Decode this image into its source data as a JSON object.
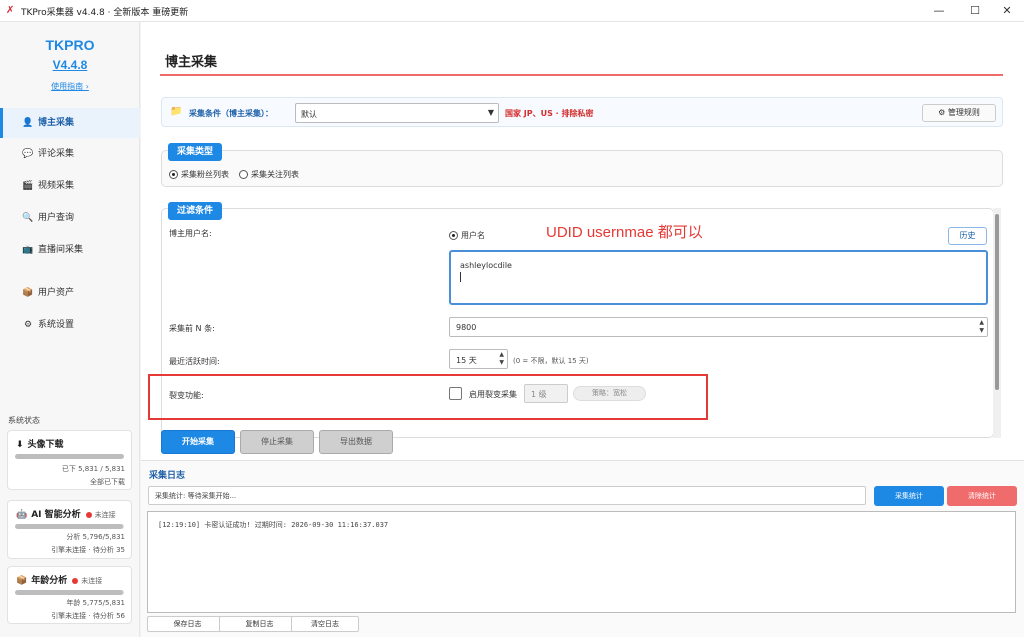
{
  "window": {
    "title": "TKPro采集器 v4.4.8 · 全新版本 重磅更新",
    "minimize": "—",
    "maximize": "☐",
    "close": "✕"
  },
  "sidebar": {
    "logo": "TKPRO",
    "version": "V4.4.8",
    "guide": "使用指南 ›",
    "items": [
      {
        "icon": "👤",
        "label": "博主采集"
      },
      {
        "icon": "💬",
        "label": "评论采集"
      },
      {
        "icon": "🎬",
        "label": "视频采集"
      },
      {
        "icon": "🔍",
        "label": "用户查询"
      },
      {
        "icon": "📺",
        "label": "直播间采集"
      },
      {
        "icon": "📦",
        "label": "用户资产"
      },
      {
        "icon": "⚙",
        "label": "系统设置"
      }
    ],
    "system_status": "系统状态",
    "cards": [
      {
        "icon": "⬇",
        "title": "头像下载",
        "status": "",
        "line1": "已下 5,831 / 5,831",
        "line2": "全部已下载",
        "progress": 1.0
      },
      {
        "icon": "🤖",
        "title": "AI 智能分析",
        "status": "未连接",
        "line1": "分析 5,796/5,831",
        "line2": "引擎未连接 · 待分析 35",
        "progress": 0.994
      },
      {
        "icon": "📦",
        "title": "年龄分析",
        "status": "未连接",
        "line1": "年龄 5,775/5,831",
        "line2": "引擎未连接 · 待分析 56",
        "progress": 0.99
      }
    ]
  },
  "main": {
    "page_title": "博主采集",
    "condition": {
      "label": "采集条件（博主采集）：",
      "selected": "默认",
      "note": "国家 JP、US · 排除私密",
      "manage_label": "管理规则"
    },
    "collect_type": {
      "tag": "采集类型",
      "options": [
        "采集粉丝列表",
        "采集关注列表"
      ],
      "selected_index": 0
    },
    "filter": {
      "tag": "过滤条件",
      "username_label": "博主用户名:",
      "username_radio": "用户名",
      "annotation": "UDID usernmae 都可以",
      "history_label": "历史",
      "username_value": "ashleylocdile",
      "topn_label": "采集前 N 条:",
      "topn_value": "9800",
      "active_label": "最近活跃时间:",
      "active_value": "15 天",
      "active_hint": "(0 = 不限，默认 15 天)",
      "fission_label": "裂变功能:",
      "fission_enable": "启用裂变采集",
      "fission_level": "1 级",
      "fission_strategy": "策略：宽松"
    },
    "actions": {
      "start": "开始采集",
      "stop": "停止采集",
      "export": "导出数据"
    },
    "log": {
      "title": "采集日志",
      "stats": "采集统计: 等待采集开始...",
      "stats_btn": "采集统计",
      "clear_stats_btn": "清除统计",
      "lines": [
        "[12:19:10] 卡密认证成功! 过期时间: 2026-09-30 11:16:37.037"
      ],
      "save": "保存日志",
      "copy": "复制日志",
      "clear": "清空日志"
    }
  },
  "colors": {
    "accent": "#1e88e5",
    "danger": "#e53935",
    "clear_btn": "#f06b6b"
  }
}
